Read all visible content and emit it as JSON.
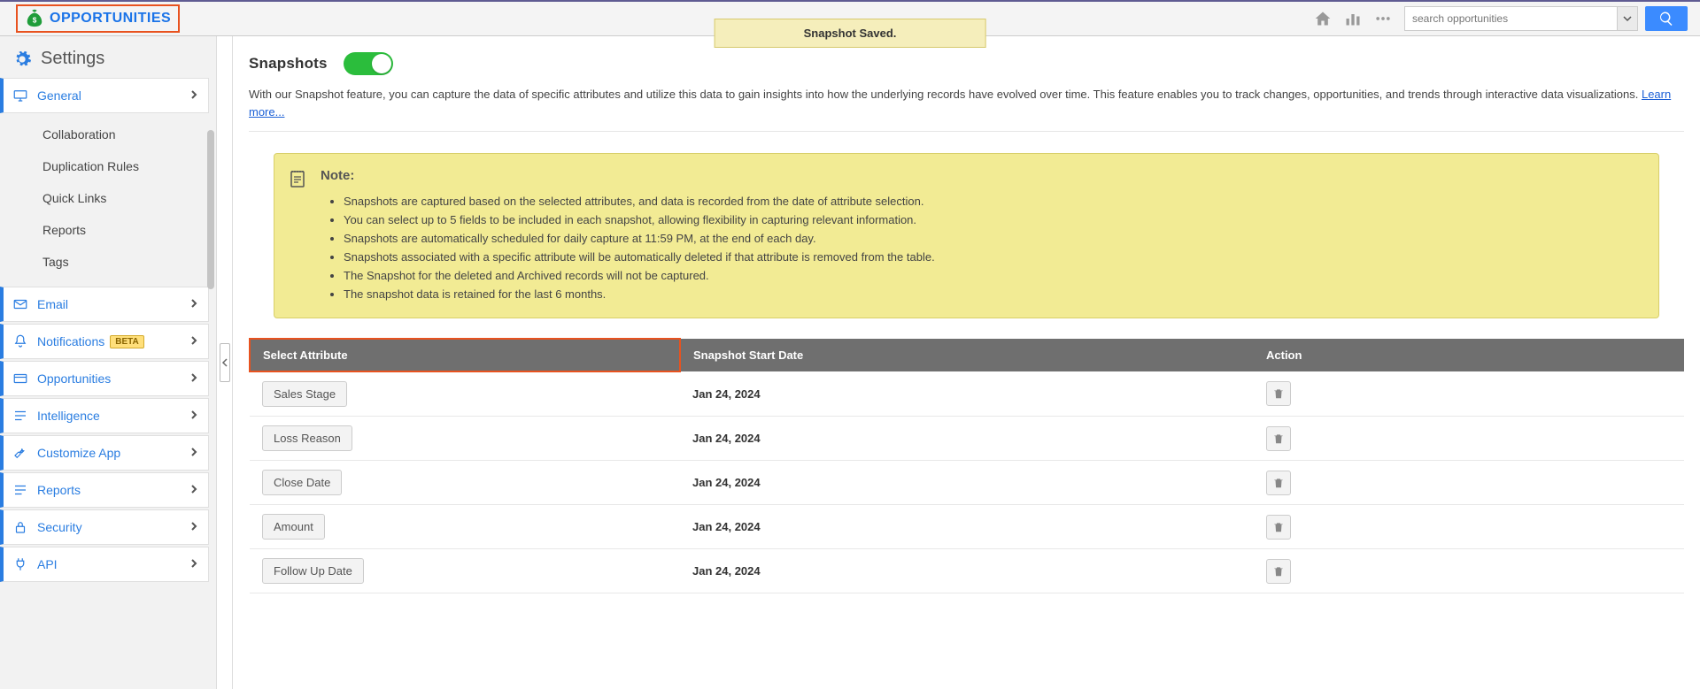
{
  "header": {
    "brand": "OPPORTUNITIES",
    "banner": "Snapshot Saved.",
    "search_placeholder": "search opportunities"
  },
  "sidebar": {
    "title": "Settings",
    "items": [
      {
        "label": "General",
        "sub": [
          "Collaboration",
          "Duplication Rules",
          "Quick Links",
          "Reports",
          "Tags"
        ]
      },
      {
        "label": "Email"
      },
      {
        "label": "Notifications",
        "badge": "BETA"
      },
      {
        "label": "Opportunities"
      },
      {
        "label": "Intelligence"
      },
      {
        "label": "Customize App"
      },
      {
        "label": "Reports"
      },
      {
        "label": "Security"
      },
      {
        "label": "API"
      }
    ]
  },
  "page": {
    "title": "Snapshots",
    "desc": "With our Snapshot feature, you can capture the data of specific attributes and utilize this data to gain insights into how the underlying records have evolved over time. This feature enables you to track changes, opportunities, and trends through interactive data visualizations. ",
    "learn_more": "Learn more...",
    "note_title": "Note:",
    "notes": [
      "Snapshots are captured based on the selected attributes, and data is recorded from the date of attribute selection.",
      "You can select up to 5 fields to be included in each snapshot, allowing flexibility in capturing relevant information.",
      "Snapshots are automatically scheduled for daily capture at 11:59 PM, at the end of each day.",
      "Snapshots associated with a specific attribute will be automatically deleted if that attribute is removed from the table.",
      "The Snapshot for the deleted and Archived records will not be captured.",
      "The snapshot data is retained for the last 6 months."
    ],
    "table": {
      "cols": [
        "Select Attribute",
        "Snapshot Start Date",
        "Action"
      ],
      "rows": [
        {
          "attr": "Sales Stage",
          "date": "Jan 24, 2024"
        },
        {
          "attr": "Loss Reason",
          "date": "Jan 24, 2024"
        },
        {
          "attr": "Close Date",
          "date": "Jan 24, 2024"
        },
        {
          "attr": "Amount",
          "date": "Jan 24, 2024"
        },
        {
          "attr": "Follow Up Date",
          "date": "Jan 24, 2024"
        }
      ]
    }
  }
}
